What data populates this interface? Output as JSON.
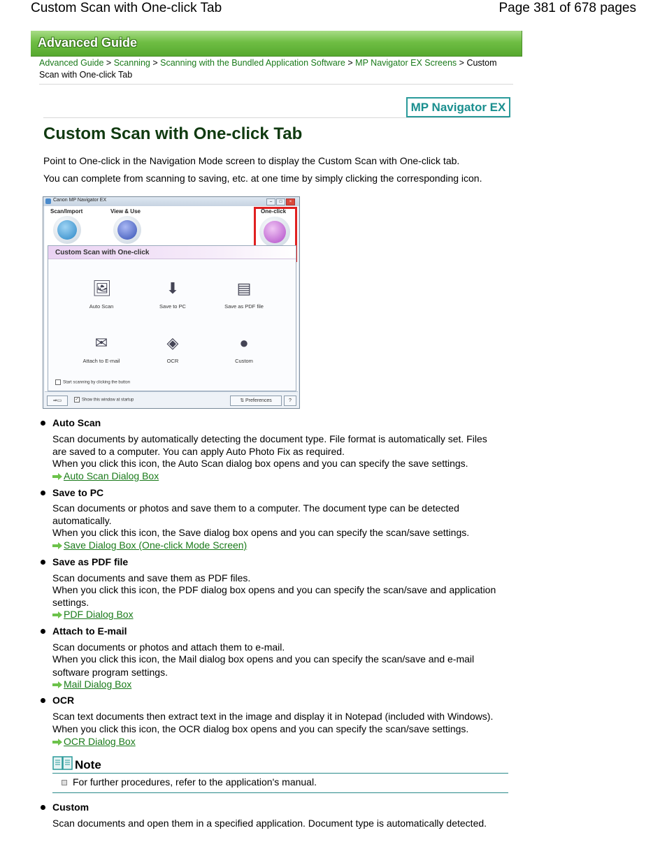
{
  "header": {
    "title": "Custom Scan with One-click Tab",
    "page": "Page 381 of 678 pages"
  },
  "banner": {
    "label": "Advanced Guide"
  },
  "breadcrumb": {
    "items": [
      "Advanced Guide",
      "Scanning",
      "Scanning with the Bundled Application Software",
      "MP Navigator EX Screens"
    ],
    "current": "Custom Scan with One-click Tab",
    "separator": ">"
  },
  "product_logo": "MP Navigator EX",
  "title": "Custom Scan with One-click Tab",
  "intro": [
    "Point to One-click in the Navigation Mode screen to display the Custom Scan with One-click tab.",
    "You can complete from scanning to saving, etc. at one time by simply clicking the corresponding icon."
  ],
  "screenshot": {
    "window_title": "Canon MP Navigator EX",
    "nav": [
      "Scan/Import",
      "View & Use",
      "One-click"
    ],
    "panel_title": "Custom Scan with One-click",
    "functions": [
      "Auto Scan",
      "Save to PC",
      "Save as PDF file",
      "Attach to E-mail",
      "OCR",
      "Custom"
    ],
    "checkbox_start": "Start scanning by clicking the button",
    "checkbox_show": "Show this window at startup",
    "preferences": "Preferences",
    "help": "?"
  },
  "items": [
    {
      "title": "Auto Scan",
      "lines": [
        "Scan documents by automatically detecting the document type. File format is automatically set. Files",
        "are saved to a computer. You can apply Auto Photo Fix as required.",
        "When you click this icon, the Auto Scan dialog box opens and you can specify the save settings."
      ],
      "link": "Auto Scan Dialog Box"
    },
    {
      "title": "Save to PC",
      "lines": [
        "Scan documents or photos and save them to a computer. The document type can be detected",
        "automatically.",
        "When you click this icon, the Save dialog box opens and you can specify the scan/save settings."
      ],
      "link": "Save Dialog Box (One-click Mode Screen)"
    },
    {
      "title": "Save as PDF file",
      "lines": [
        "Scan documents and save them as PDF files.",
        "When you click this icon, the PDF dialog box opens and you can specify the scan/save and application",
        "settings."
      ],
      "link": "PDF Dialog Box"
    },
    {
      "title": "Attach to E-mail",
      "lines": [
        "Scan documents or photos and attach them to e-mail.",
        "When you click this icon, the Mail dialog box opens and you can specify the scan/save and e-mail",
        "software program settings."
      ],
      "link": "Mail Dialog Box"
    },
    {
      "title": "OCR",
      "lines": [
        "Scan text documents then extract text in the image and display it in Notepad (included with Windows).",
        "When you click this icon, the OCR dialog box opens and you can specify the scan/save settings."
      ],
      "link": "OCR Dialog Box"
    },
    {
      "title": "Custom",
      "lines": [
        "Scan documents and open them in a specified application. Document type is automatically detected."
      ]
    }
  ],
  "note": {
    "label": "Note",
    "items": [
      "For further procedures, refer to the application's manual."
    ]
  },
  "colors": {
    "link": "#1a7a1a",
    "banner": "#6fbe44",
    "title": "#103a10",
    "note_rule": "#2a8a8a",
    "highlight": "#e02020"
  }
}
